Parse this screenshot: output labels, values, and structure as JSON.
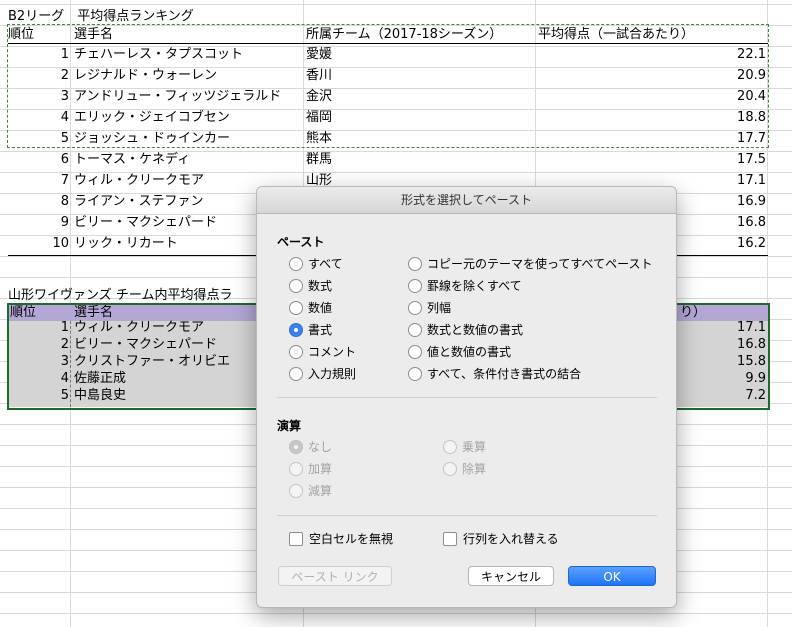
{
  "sheet": {
    "title1": "B2リーグ　平均得点ランキング",
    "header1": {
      "rank": "順位",
      "player": "選手名",
      "team": "所属チーム（2017-18シーズン）",
      "avg": "平均得点（一試合あたり）"
    },
    "rows1": [
      {
        "rank": "1",
        "player": "チェハーレス・タプスコット",
        "team": "愛媛",
        "avg": "22.1"
      },
      {
        "rank": "2",
        "player": "レジナルド・ウォーレン",
        "team": "香川",
        "avg": "20.9"
      },
      {
        "rank": "3",
        "player": "アンドリュー・フィッツジェラルド",
        "team": "金沢",
        "avg": "20.4"
      },
      {
        "rank": "4",
        "player": "エリック・ジェイコブセン",
        "team": "福岡",
        "avg": "18.8"
      },
      {
        "rank": "5",
        "player": "ジョッシュ・ドゥインカー",
        "team": "熊本",
        "avg": "17.7"
      },
      {
        "rank": "6",
        "player": "トーマス・ケネディ",
        "team": "群馬",
        "avg": "17.5"
      },
      {
        "rank": "7",
        "player": "ウィル・クリークモア",
        "team": "山形",
        "avg": "17.1"
      },
      {
        "rank": "8",
        "player": "ライアン・ステファン",
        "team": "",
        "avg": "16.9"
      },
      {
        "rank": "9",
        "player": "ビリー・マクシェパード",
        "team": "",
        "avg": "16.8"
      },
      {
        "rank": "10",
        "player": "リック・リカート",
        "team": "",
        "avg": "16.2"
      }
    ],
    "title2": "山形ワイヴァンズ チーム内平均得点ラ",
    "header2": {
      "rank": "順位",
      "player": "選手名",
      "avg": "り）"
    },
    "rows2": [
      {
        "rank": "1",
        "player": "ウィル・クリークモア",
        "avg": "17.1"
      },
      {
        "rank": "2",
        "player": "ビリー・マクシェパード",
        "avg": "16.8"
      },
      {
        "rank": "3",
        "player": "クリストファー・オリビエ",
        "avg": "15.8"
      },
      {
        "rank": "4",
        "player": "佐藤正成",
        "avg": "9.9"
      },
      {
        "rank": "5",
        "player": "中島良史",
        "avg": "7.2"
      }
    ]
  },
  "dialog": {
    "title": "形式を選択してペースト",
    "paste_section": "ペースト",
    "paste_left": [
      "すべて",
      "数式",
      "数値",
      "書式",
      "コメント",
      "入力規則"
    ],
    "paste_right": [
      "コピー元のテーマを使ってすべてペースト",
      "罫線を除くすべて",
      "列幅",
      "数式と数値の書式",
      "値と数値の書式",
      "すべて、条件付き書式の結合"
    ],
    "paste_selected": "書式",
    "operation_section": "演算",
    "operation_left": [
      "なし",
      "加算",
      "減算"
    ],
    "operation_right": [
      "乗算",
      "除算"
    ],
    "operation_selected": "なし",
    "skip_blanks": "空白セルを無視",
    "transpose": "行列を入れ替える",
    "paste_link_button": "ペースト リンク",
    "cancel_button": "キャンセル",
    "ok_button": "OK"
  },
  "colors": {
    "accent": "#1d74f5",
    "header2_fill": "#b4a7d6",
    "table2_fill": "#d4d4d4",
    "selection": "#1e6b2e",
    "copy_marquee": "#3a8a3a"
  }
}
